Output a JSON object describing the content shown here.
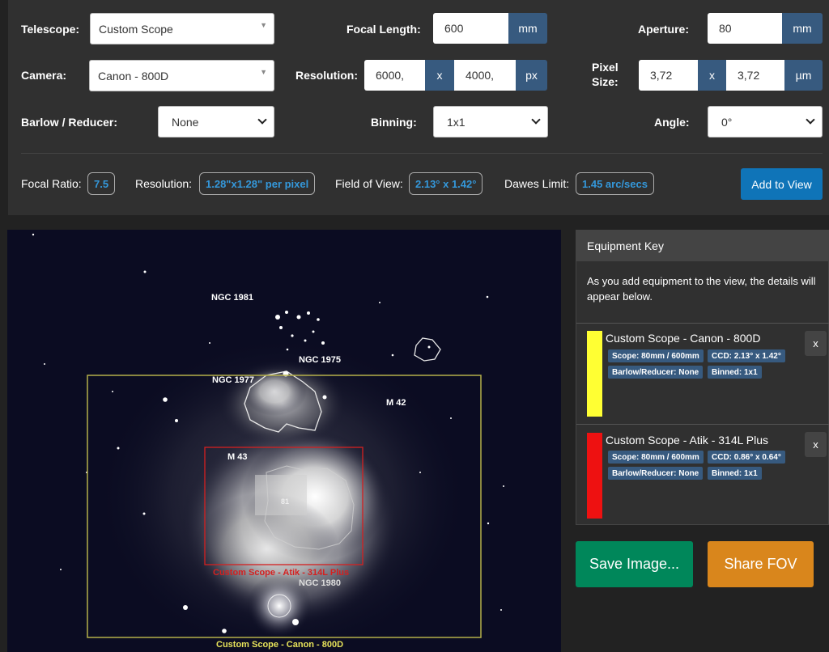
{
  "form": {
    "telescope": {
      "label": "Telescope:",
      "value": "Custom Scope"
    },
    "focal_length": {
      "label": "Focal Length:",
      "value": "600",
      "unit": "mm"
    },
    "aperture": {
      "label": "Aperture:",
      "value": "80",
      "unit": "mm"
    },
    "camera": {
      "label": "Camera:",
      "value": "Canon - 800D"
    },
    "resolution": {
      "label": "Resolution:",
      "width": "6000,",
      "times": "x",
      "height": "4000,",
      "unit": "px"
    },
    "pixel_size": {
      "label_line1": "Pixel",
      "label_line2": "Size:",
      "width": "3,72",
      "times": "x",
      "height": "3,72",
      "unit": "µm"
    },
    "barlow": {
      "label": "Barlow / Reducer:",
      "value": "None"
    },
    "binning": {
      "label": "Binning:",
      "value": "1x1"
    },
    "angle": {
      "label": "Angle:",
      "value": "0°"
    }
  },
  "stats": {
    "focal_ratio": {
      "label": "Focal Ratio:",
      "value": "7.5"
    },
    "resolution": {
      "label": "Resolution:",
      "value": "1.28\"x1.28\" per pixel"
    },
    "fov": {
      "label": "Field of View:",
      "value": "2.13° x 1.42°"
    },
    "dawes": {
      "label": "Dawes Limit:",
      "value": "1.45 arc/secs"
    },
    "add_button": "Add to View"
  },
  "sky": {
    "labels": {
      "ngc1981": "NGC 1981",
      "ngc1975": "NGC 1975",
      "ngc1977": "NGC 1977",
      "m42": "M 42",
      "m43": "M 43",
      "ngc1980": "NGC 1980",
      "num81": "81"
    },
    "fov_canon": "Custom Scope - Canon - 800D",
    "fov_atik": "Custom Scope - Atik - 314L Plus",
    "colors": {
      "canon": "#b5b04a",
      "atik": "#d42020",
      "background": "#0b0c22"
    }
  },
  "equipment_key": {
    "title": "Equipment Key",
    "intro": "As you add equipment to the view, the details will appear below.",
    "items": [
      {
        "title": "Custom Scope - Canon - 800D",
        "color": "#ffff33",
        "chips": [
          "Scope: 80mm / 600mm",
          "CCD: 2.13° x 1.42°",
          "Barlow/Reducer: None",
          "Binned: 1x1"
        ],
        "close": "x"
      },
      {
        "title": "Custom Scope - Atik - 314L Plus",
        "color": "#ee1111",
        "chips": [
          "Scope: 80mm / 600mm",
          "CCD: 0.86° x 0.64°",
          "Barlow/Reducer: None",
          "Binned: 1x1"
        ],
        "close": "x"
      }
    ]
  },
  "actions": {
    "save": "Save Image...",
    "share": "Share FOV"
  },
  "theme": {
    "primary": "#375a7f",
    "save": "#00875a",
    "share": "#d9861c",
    "accent": "#3498db"
  }
}
